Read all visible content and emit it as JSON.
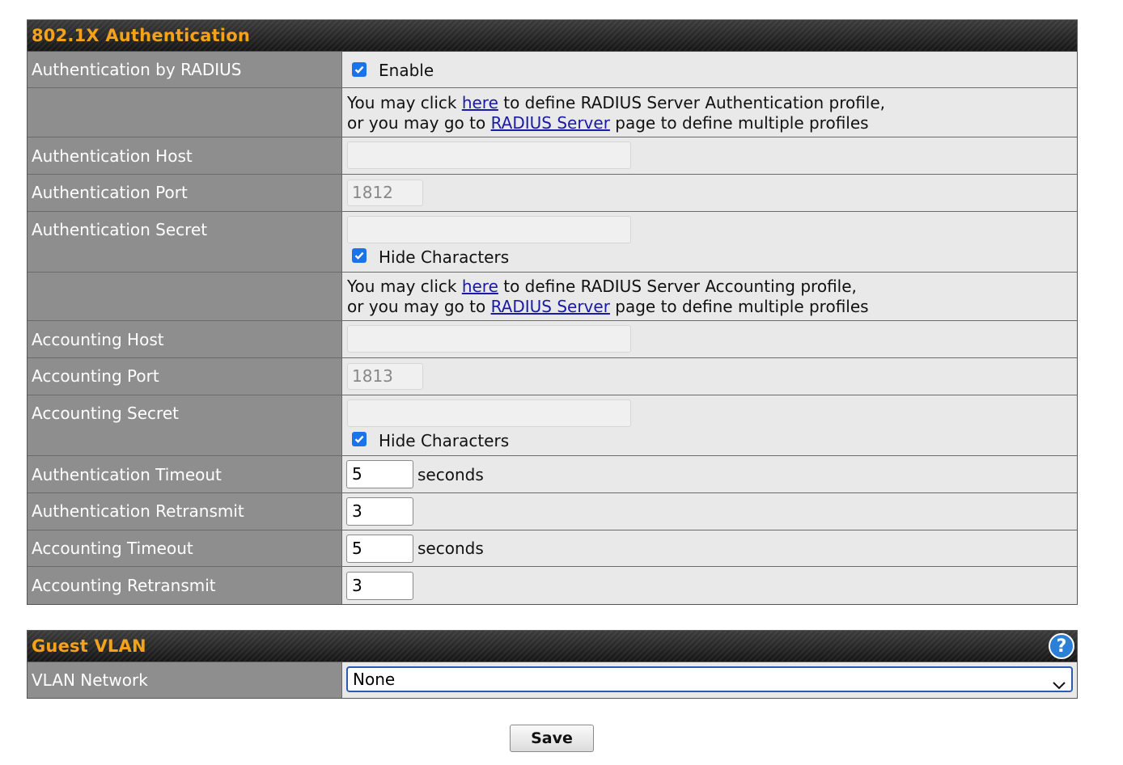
{
  "auth_section": {
    "title": "802.1X Authentication",
    "radius_label": "Authentication by RADIUS",
    "radius_enable_label": "Enable",
    "radius_enabled": true,
    "auth_info": {
      "line1_pre": "You may click ",
      "link_here": "here",
      "line1_post": " to define RADIUS Server Authentication profile,",
      "line2_pre": "or you may go to ",
      "link_radius": "RADIUS Server",
      "line2_post": " page to define multiple profiles"
    },
    "auth_host_label": "Authentication Host",
    "auth_host_value": "",
    "auth_port_label": "Authentication Port",
    "auth_port_value": "1812",
    "auth_secret_label": "Authentication Secret",
    "auth_secret_value": "",
    "auth_hide_label": "Hide Characters",
    "acct_info": {
      "line1_pre": "You may click ",
      "link_here": "here",
      "line1_post": " to define RADIUS Server Accounting profile,",
      "line2_pre": "or you may go to ",
      "link_radius": "RADIUS Server",
      "line2_post": " page to define multiple profiles"
    },
    "acct_host_label": "Accounting Host",
    "acct_host_value": "",
    "acct_port_label": "Accounting Port",
    "acct_port_value": "1813",
    "acct_secret_label": "Accounting Secret",
    "acct_secret_value": "",
    "acct_hide_label": "Hide Characters",
    "auth_timeout_label": "Authentication Timeout",
    "auth_timeout_value": "5",
    "auth_timeout_unit": "seconds",
    "auth_retransmit_label": "Authentication Retransmit",
    "auth_retransmit_value": "3",
    "acct_timeout_label": "Accounting Timeout",
    "acct_timeout_value": "5",
    "acct_timeout_unit": "seconds",
    "acct_retransmit_label": "Accounting Retransmit",
    "acct_retransmit_value": "3"
  },
  "guest_vlan": {
    "title": "Guest VLAN",
    "help_icon": "question-mark-icon",
    "help_glyph": "?",
    "vlan_label": "VLAN Network",
    "vlan_selected": "None"
  },
  "actions": {
    "save_label": "Save"
  },
  "colors": {
    "header_title": "#f4a21a",
    "label_bg": "#8e8e8e",
    "value_bg": "#e9e9e9",
    "link": "#1a1aa6",
    "checkbox": "#1a73e8"
  }
}
